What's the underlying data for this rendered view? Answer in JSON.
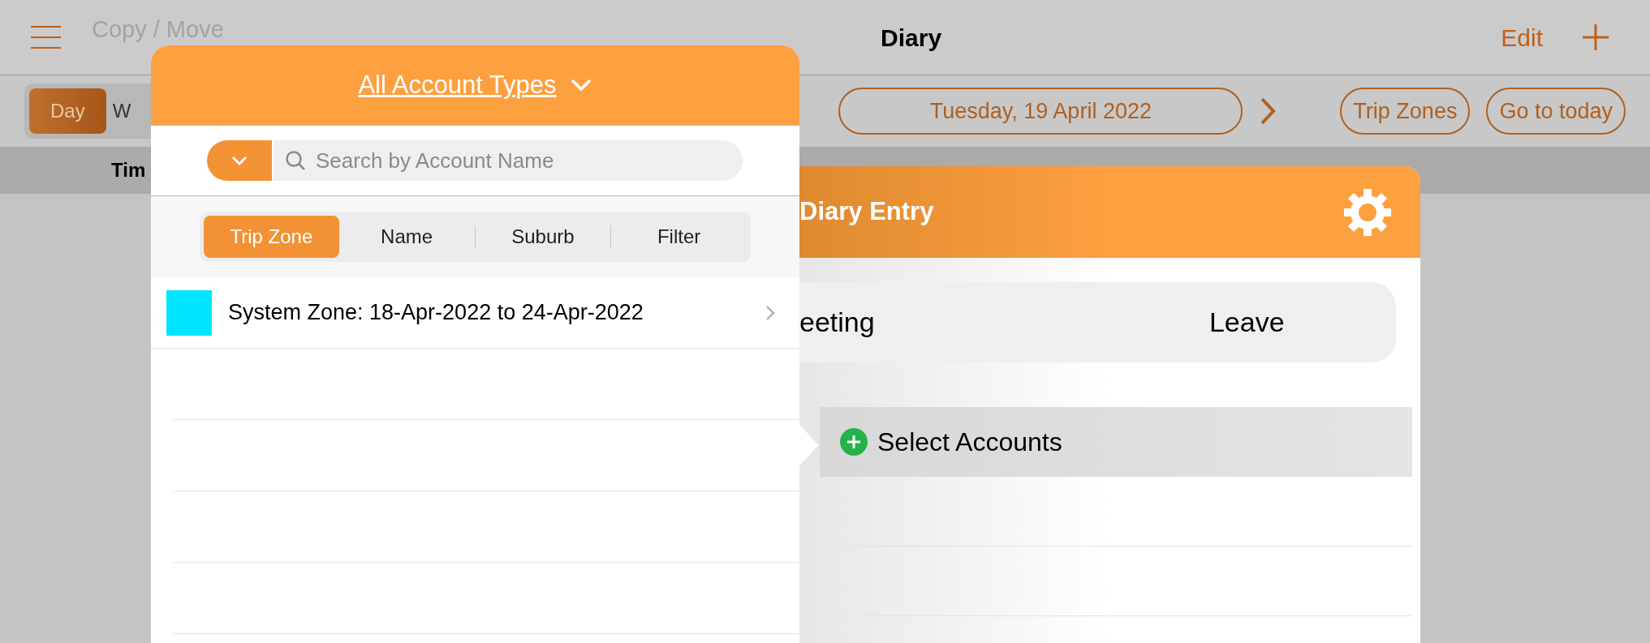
{
  "nav": {
    "left_action": {
      "label": "Copy / Move",
      "disabled": true
    },
    "title": "Diary",
    "edit": "Edit"
  },
  "view_tabs": [
    {
      "label": "Day",
      "selected": true
    },
    {
      "label": "W",
      "selected": false
    }
  ],
  "date": "Tuesday, 19 April 2022",
  "buttons": [
    "Trip Zones",
    "Go to today"
  ],
  "columns": [
    "Tim"
  ],
  "popover": {
    "title": "All Account Types",
    "search_placeholder": "Search by Account Name",
    "tabs": [
      {
        "label": "Trip Zone",
        "selected": true
      },
      {
        "label": "Name",
        "selected": false
      },
      {
        "label": "Suburb",
        "selected": false
      },
      {
        "label": "Filter",
        "selected": false
      }
    ],
    "rows": [
      {
        "label": "System Zone: 18-Apr-2022 to 24-Apr-2022",
        "color": "#00e5ff"
      }
    ]
  },
  "entry": {
    "title": "Diary Entry",
    "types": [
      {
        "label": "eeting",
        "selected": false
      },
      {
        "label": "Leave",
        "selected": false
      }
    ],
    "select_label": "Select Accounts"
  }
}
